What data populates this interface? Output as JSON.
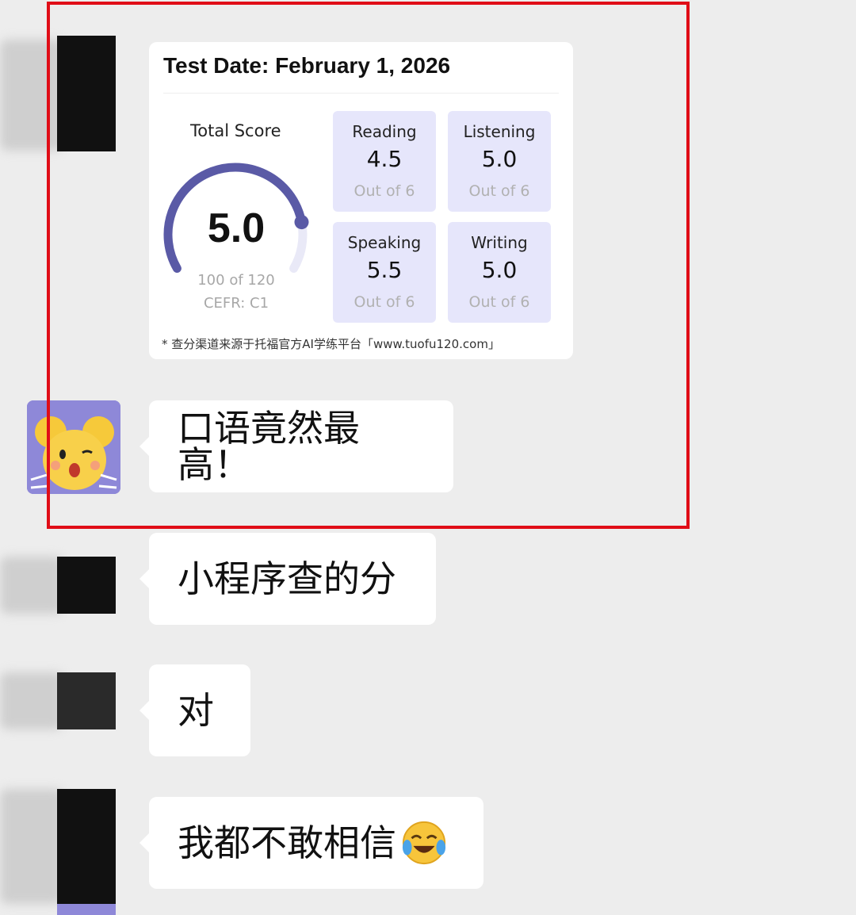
{
  "score_card": {
    "test_date": "Test Date: February 1, 2026",
    "total_label": "Total Score",
    "total_score": "5.0",
    "total_points": "100 of 120",
    "cefr": "CEFR: C1",
    "total_fraction": 0.83,
    "sections": [
      {
        "label": "Reading",
        "score": "4.5",
        "out_of": "Out of 6"
      },
      {
        "label": "Listening",
        "score": "5.0",
        "out_of": "Out of 6"
      },
      {
        "label": "Speaking",
        "score": "5.5",
        "out_of": "Out of 6"
      },
      {
        "label": "Writing",
        "score": "5.0",
        "out_of": "Out of 6"
      }
    ],
    "footnote": "* 查分渠道来源于托福官方AI学练平台「www.tuofu120.com」",
    "accent_color": "#5a5aa6"
  },
  "messages": [
    {
      "text": "口语竟然最高！",
      "sender": "cartoon-avatar"
    },
    {
      "text": "小程序查的分",
      "sender": "blurred-avatar"
    },
    {
      "text": "对",
      "sender": "blurred-avatar"
    },
    {
      "text": "我都不敢相信",
      "emoji": "face-with-tears-of-joy",
      "sender": "blurred-avatar"
    }
  ],
  "highlight_color": "#e00d17"
}
